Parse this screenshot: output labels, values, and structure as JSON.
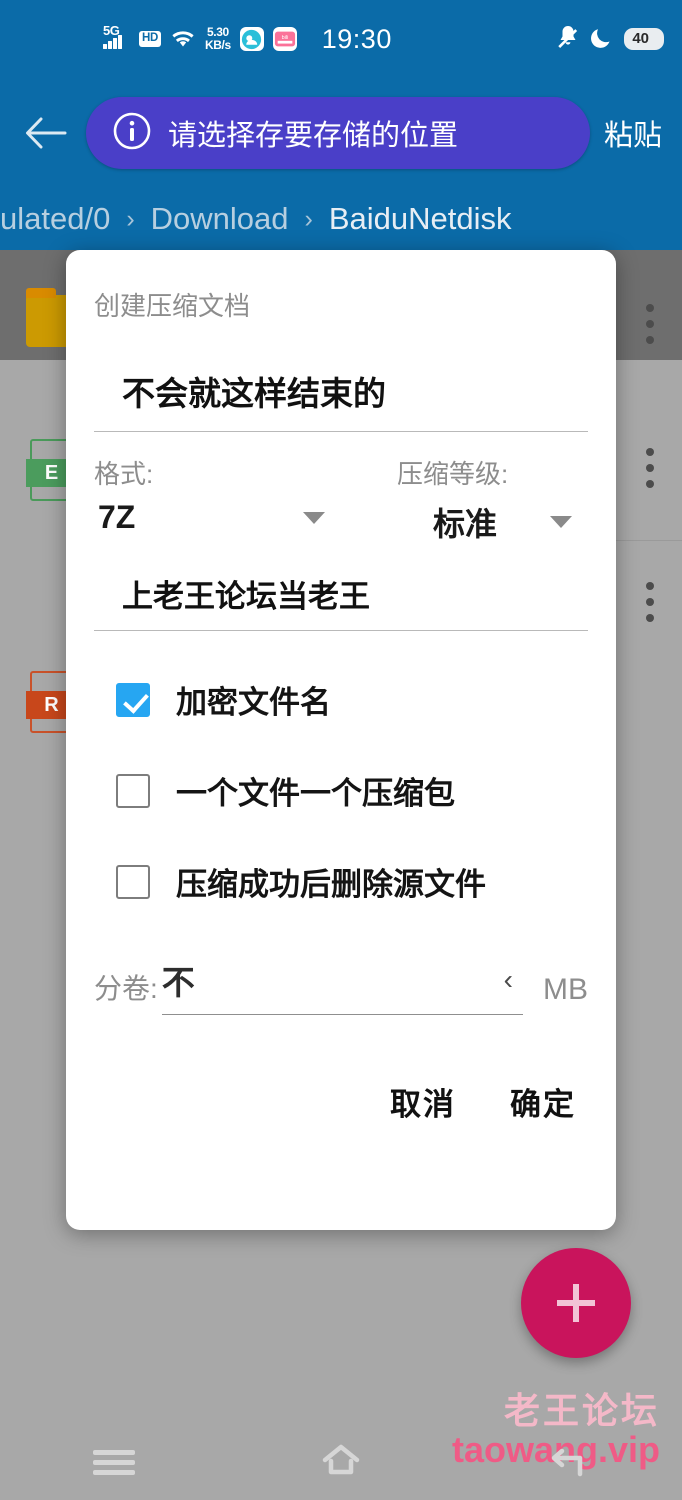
{
  "status_bar": {
    "network_type": "5G",
    "hd_label": "HD",
    "data_rate_value": "5.30",
    "data_rate_unit": "KB/s",
    "icons": [
      "signal-icon",
      "hd-icon",
      "wifi-icon",
      "data-rate-icon",
      "cloud-app-icon",
      "bilibili-app-icon"
    ],
    "clock": "19:30",
    "right_icons": [
      "notification-muted-icon",
      "do-not-disturb-moon-icon"
    ],
    "battery_percent": "40"
  },
  "toolbar": {
    "back_icon": "arrow-left-icon",
    "info_icon": "info-circle-icon",
    "info_text": "请选择存要存储的位置",
    "paste_label": "粘贴",
    "chip_color": "#4a3fc8",
    "bar_color": "#0b6ba8"
  },
  "breadcrumb": {
    "separator": "›",
    "items": [
      "ulated/0",
      "Download",
      "BaiduNetdisk"
    ]
  },
  "file_list": {
    "rows": [
      {
        "icon": "folder-icon",
        "icon_color": "#cc9a02",
        "selected": true,
        "overflow": "more-vertical-icon"
      },
      {
        "icon": "excel-document-icon",
        "icon_tag": "E",
        "icon_color": "#4b9c5d",
        "selected": false,
        "overflow": "more-vertical-icon"
      },
      {
        "icon": "pdf-document-icon",
        "icon_tag": "R",
        "icon_color": "#c8471b",
        "selected": false,
        "overflow": "more-vertical-icon"
      }
    ]
  },
  "dialog": {
    "title": "创建压缩文档",
    "archive_name": "不会就这样结束的",
    "format": {
      "label": "格式:",
      "value": "7Z",
      "caret": "chevron-down-icon"
    },
    "level": {
      "label": "压缩等级:",
      "value": "标准",
      "caret": "chevron-down-icon"
    },
    "password": "上老王论坛当老王",
    "checkboxes": [
      {
        "label": "加密文件名",
        "checked": true
      },
      {
        "label": "一个文件一个压缩包",
        "checked": false
      },
      {
        "label": "压缩成功后删除源文件",
        "checked": false
      }
    ],
    "split": {
      "label": "分卷:",
      "value": "不",
      "stepper_icon": "chevron-left-icon",
      "unit": "MB"
    },
    "cancel_label": "取消",
    "confirm_label": "确定",
    "checkbox_accent": "#26a6f2"
  },
  "fab": {
    "icon": "plus-icon",
    "color": "#c9145c"
  },
  "watermark": {
    "line1": "老王论坛",
    "line2": "taowang.vip",
    "color1": "#f4b8c8",
    "color2": "#ef5b86"
  },
  "navbar": {
    "buttons": [
      {
        "name": "recents-button",
        "icon": "menu-lines-icon"
      },
      {
        "name": "home-button",
        "icon": "home-icon"
      },
      {
        "name": "back-button",
        "icon": "arrow-back-icon"
      }
    ]
  }
}
